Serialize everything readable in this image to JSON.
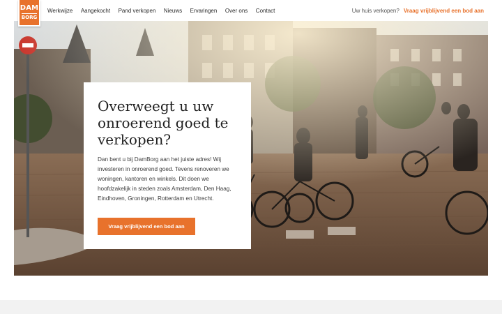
{
  "logo": {
    "line1": "DAM",
    "line2": "BORG"
  },
  "nav": {
    "items": [
      "Werkwijze",
      "Aangekocht",
      "Pand verkopen",
      "Nieuws",
      "Ervaringen",
      "Over ons",
      "Contact"
    ]
  },
  "header_right": {
    "question": "Uw huis verkopen?",
    "cta": "Vraag vrijblijvend een bod aan"
  },
  "hero": {
    "image_icon": "street-photo-cyclists",
    "title": "Overweegt u uw onroerend goed te verkopen?",
    "body": "Dan bent u bij DamBorg aan het juiste adres! Wij investeren in onroerend goed. Tevens renoveren we woningen, kantoren en winkels. Dit doen we hoofdzakelijk in steden zoals Amsterdam, Den Haag, Eindhoven, Groningen, Rotterdam en Utrecht.",
    "button": "Vraag vrijblijvend een bod aan"
  },
  "colors": {
    "accent": "#e8722c",
    "text": "#1f1f1f",
    "band": "#f2f2f2"
  }
}
